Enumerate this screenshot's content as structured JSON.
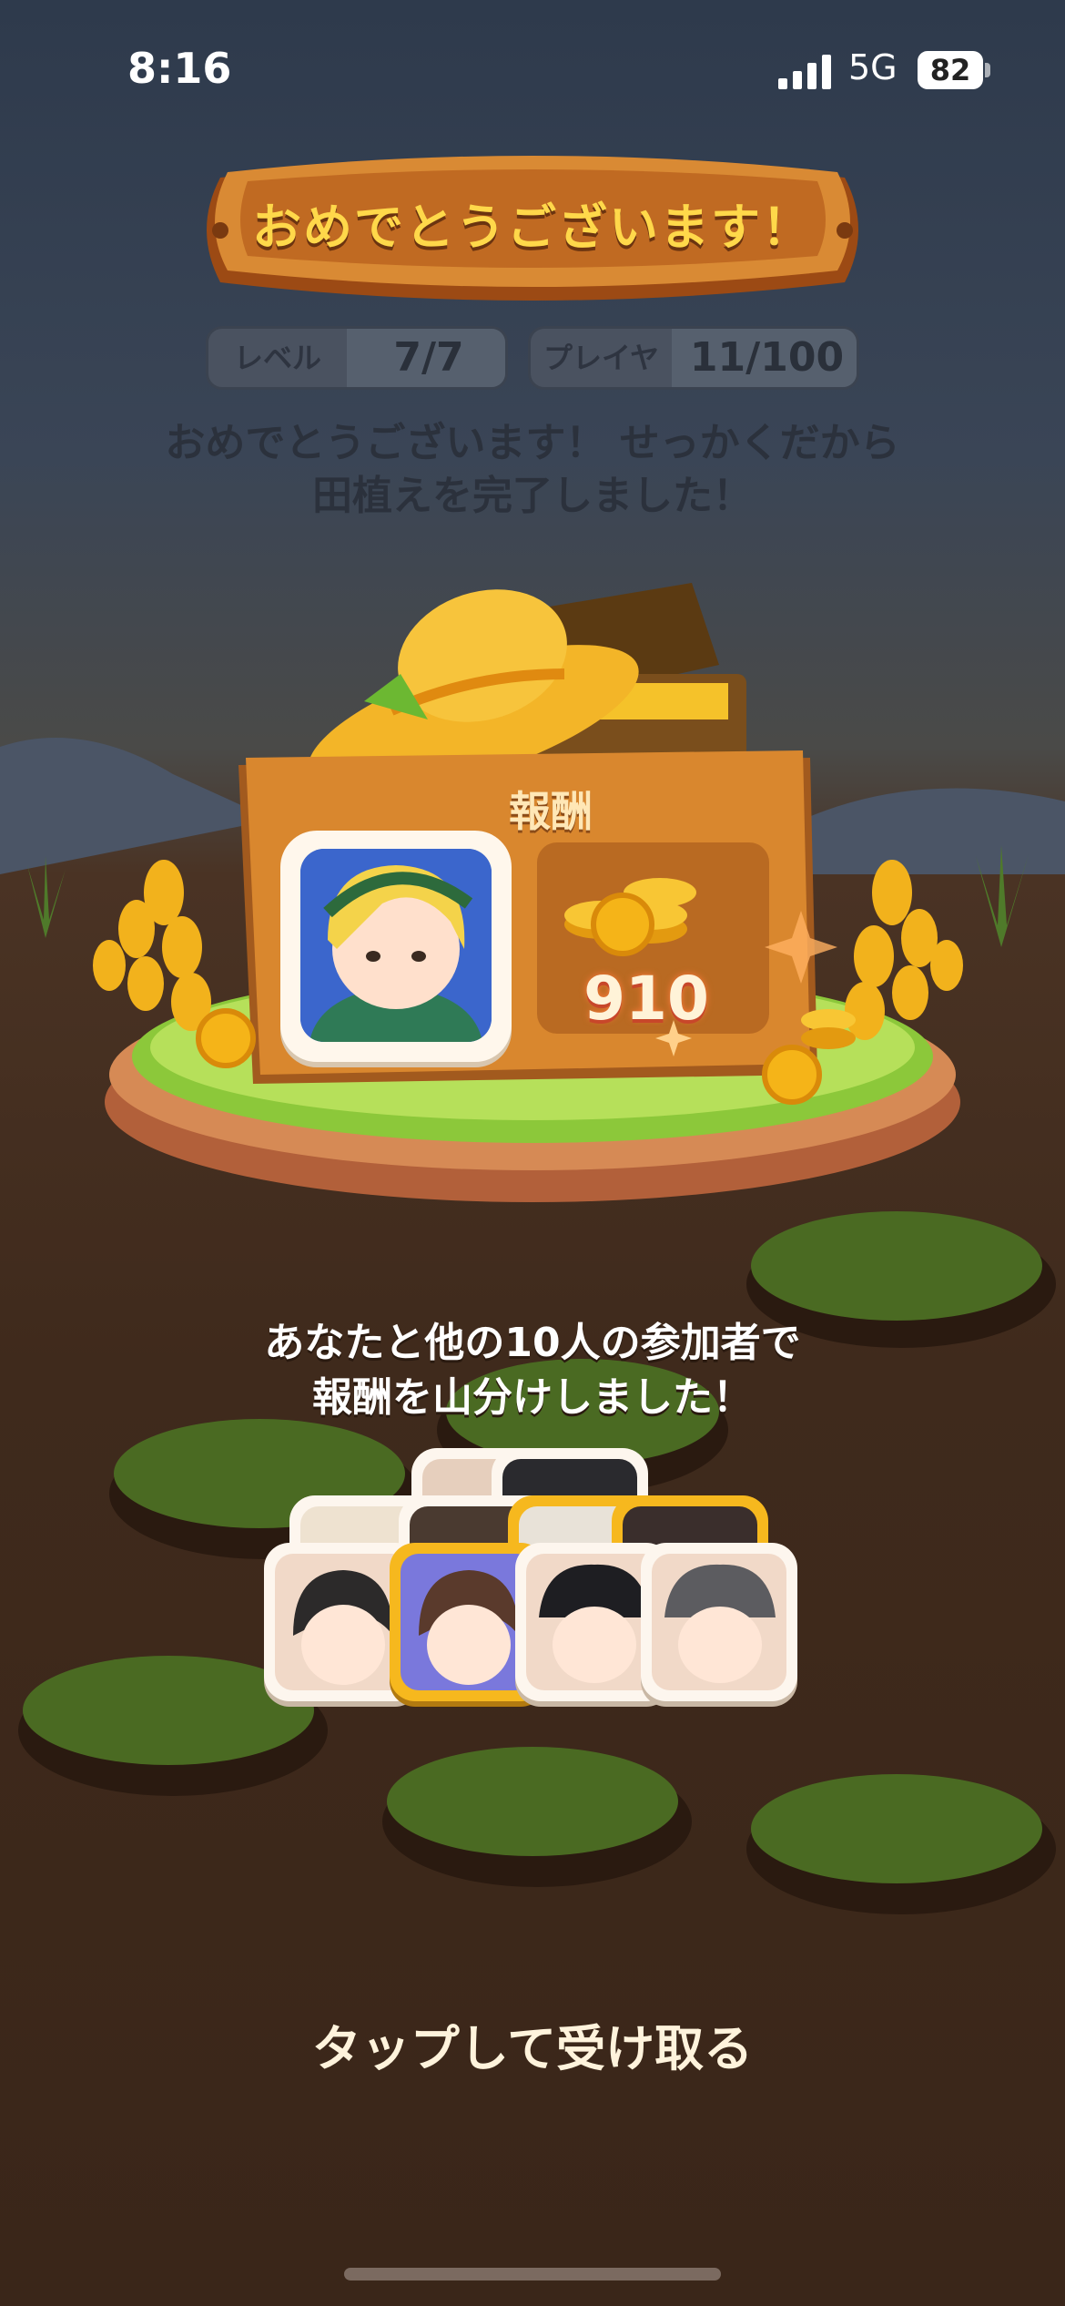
{
  "status_bar": {
    "time": "8:16",
    "network": "5G",
    "battery": "82",
    "signal_icon": "signal-bars-icon",
    "battery_icon": "battery-icon"
  },
  "header": {
    "title": "おめでとうございます！"
  },
  "stats": {
    "level_label": "レベル",
    "level_value": "7/7",
    "player_label": "プレイヤー",
    "player_value": "11/100"
  },
  "message": {
    "line1": "おめでとうございます！ せっかくだから",
    "line2": "田植えを完了しました！"
  },
  "reward": {
    "title": "報酬",
    "coins": "910",
    "coin_icon": "coin-stack-icon"
  },
  "share": {
    "line1": "あなたと他の10人の参加者で",
    "line2": "報酬を山分けしました！"
  },
  "participants": {
    "count_shown": 10
  },
  "footer": {
    "tap_label": "タップして受け取る"
  },
  "colors": {
    "banner_text": "#ffd84a",
    "wood": "#d07a2c",
    "grass": "#8cc83a",
    "coin": "#f5b418"
  }
}
